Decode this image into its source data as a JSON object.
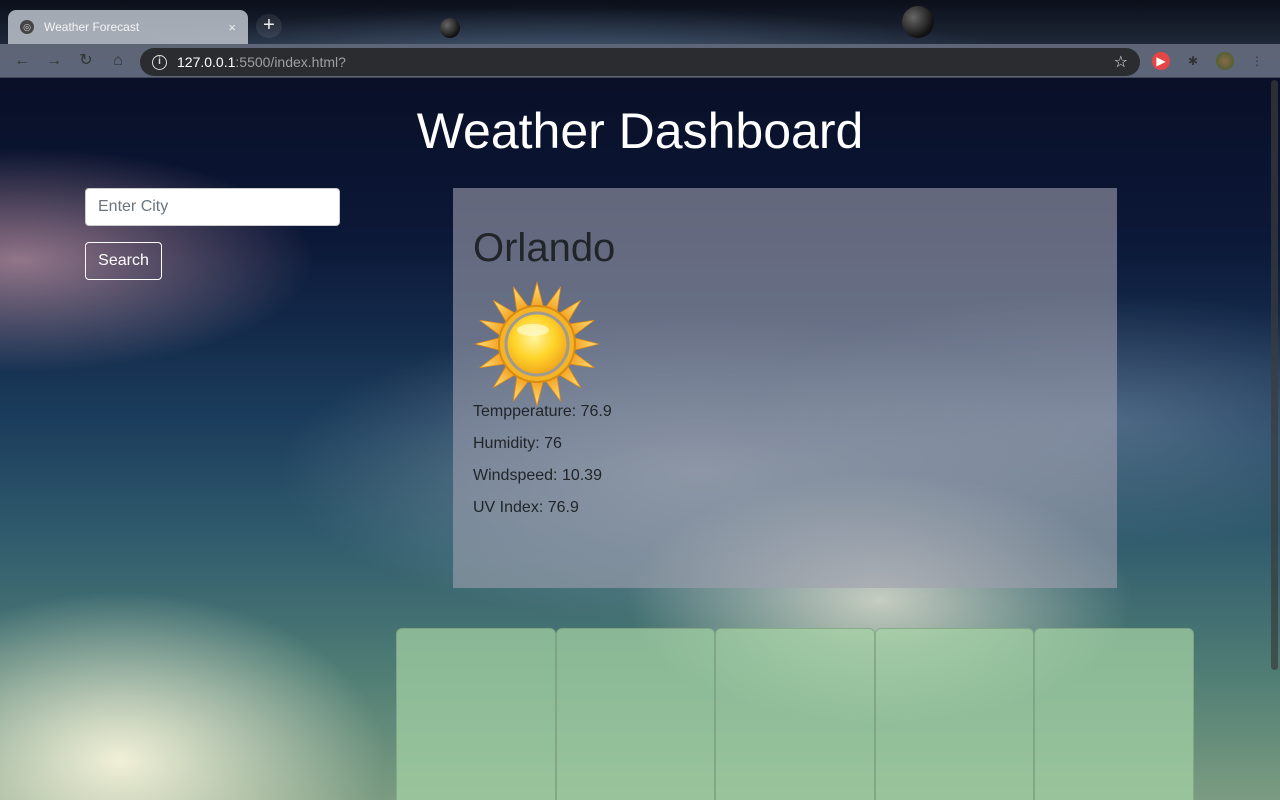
{
  "browser": {
    "tab_title": "Weather Forecast",
    "tab_close": "×",
    "new_tab": "+",
    "url_host": "127.0.0.1",
    "url_rest": ":5500/index.html?",
    "star": "☆"
  },
  "page": {
    "title": "Weather Dashboard"
  },
  "search": {
    "placeholder": "Enter City",
    "value": "",
    "button_label": "Search"
  },
  "current": {
    "city": "Orlando",
    "icon": "sun-icon",
    "temperature_label": "Tempperature: 76.9",
    "humidity_label": "Humidity: 76",
    "windspeed_label": "Windspeed: 10.39",
    "uv_label": "UV Index: 76.9"
  },
  "forecast": {
    "cards": [
      {},
      {},
      {},
      {},
      {}
    ]
  },
  "colors": {
    "card_bg": "#a0a0af",
    "forecast_bg": "#a5d2a5",
    "title_text": "#ffffff"
  }
}
